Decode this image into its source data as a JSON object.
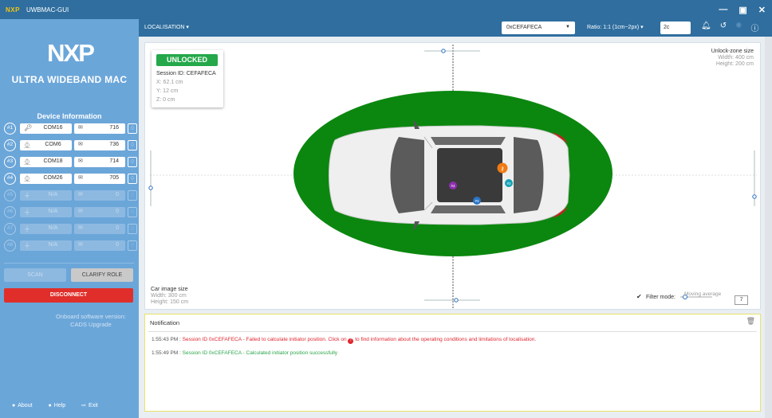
{
  "window": {
    "logo": "NXP",
    "title": "UWBMAC-GUI",
    "minimize": "—",
    "maximize": "▣",
    "close": "✕"
  },
  "sidebar": {
    "brand": "NXP",
    "product": "ULTRA WIDEBAND MAC",
    "device_info_title": "Device Information",
    "devices": [
      {
        "num": "#1",
        "port": "COM16",
        "value": "716",
        "port_icon": "key-icon",
        "active": true
      },
      {
        "num": "#2",
        "port": "COM6",
        "value": "736",
        "port_icon": "antenna-icon",
        "active": true
      },
      {
        "num": "#3",
        "port": "COM18",
        "value": "714",
        "port_icon": "antenna-icon",
        "active": true
      },
      {
        "num": "#4",
        "port": "COM26",
        "value": "705",
        "port_icon": "antenna-icon",
        "active": true
      },
      {
        "num": "#5",
        "port": "N/A",
        "value": "0",
        "port_icon": "usb-icon",
        "active": false
      },
      {
        "num": "#6",
        "port": "N/A",
        "value": "0",
        "port_icon": "usb-icon",
        "active": false
      },
      {
        "num": "#7",
        "port": "N/A",
        "value": "0",
        "port_icon": "usb-icon",
        "active": false
      },
      {
        "num": "#8",
        "port": "N/A",
        "value": "0",
        "port_icon": "usb-icon",
        "active": false
      }
    ],
    "scan_label": "SCAN",
    "clarify_label": "CLARIFY ROLE",
    "disconnect_label": "DISCONNECT",
    "onboard_line1": "Onboard software version:",
    "onboard_line2": "CADS Upgrade",
    "footer": {
      "about": "About",
      "help": "Help",
      "exit": "Exit"
    }
  },
  "toolbar": {
    "localisation_label": "LOCALISATION",
    "session_value": "0xCEFAFECA",
    "ratio_label": "Ratio: 1:1 (1cm~2px)",
    "ratio_input_value": "2c"
  },
  "canvas": {
    "status_badge": "UNLOCKED",
    "session_id": "Session ID: CEFAFECA",
    "x": "X: 62.1 cm",
    "y": "Y: 12 cm",
    "z": "Z: 0 cm",
    "unlock_zone_title": "Unlock-zone size",
    "unlock_zone_width": "Width: 400 cm",
    "unlock_zone_height": "Height: 200 cm",
    "car_size_title": "Car image size",
    "car_width": "Width: 300 cm",
    "car_height": "Height: 150 cm",
    "filter_label": "Filter mode:",
    "moving_average_label": "Moving average",
    "average_value": "7",
    "anchors": [
      "#2",
      "#3",
      "#4"
    ],
    "zone_color": "#0b870f"
  },
  "notification": {
    "title": "Notification",
    "messages": [
      {
        "time": "1:55:43 PM :",
        "text_a": "Session ID 0xCEFAFECA - Failed to calculate initiator position. Click on",
        "icon": "!",
        "text_b": "to find information about the operating conditions and limitations of localisation.",
        "type": "error"
      },
      {
        "time": "1:55:49 PM :",
        "text": "Session ID 0xCEFAFECA - Calculated initiator position successfully",
        "type": "success"
      }
    ]
  }
}
